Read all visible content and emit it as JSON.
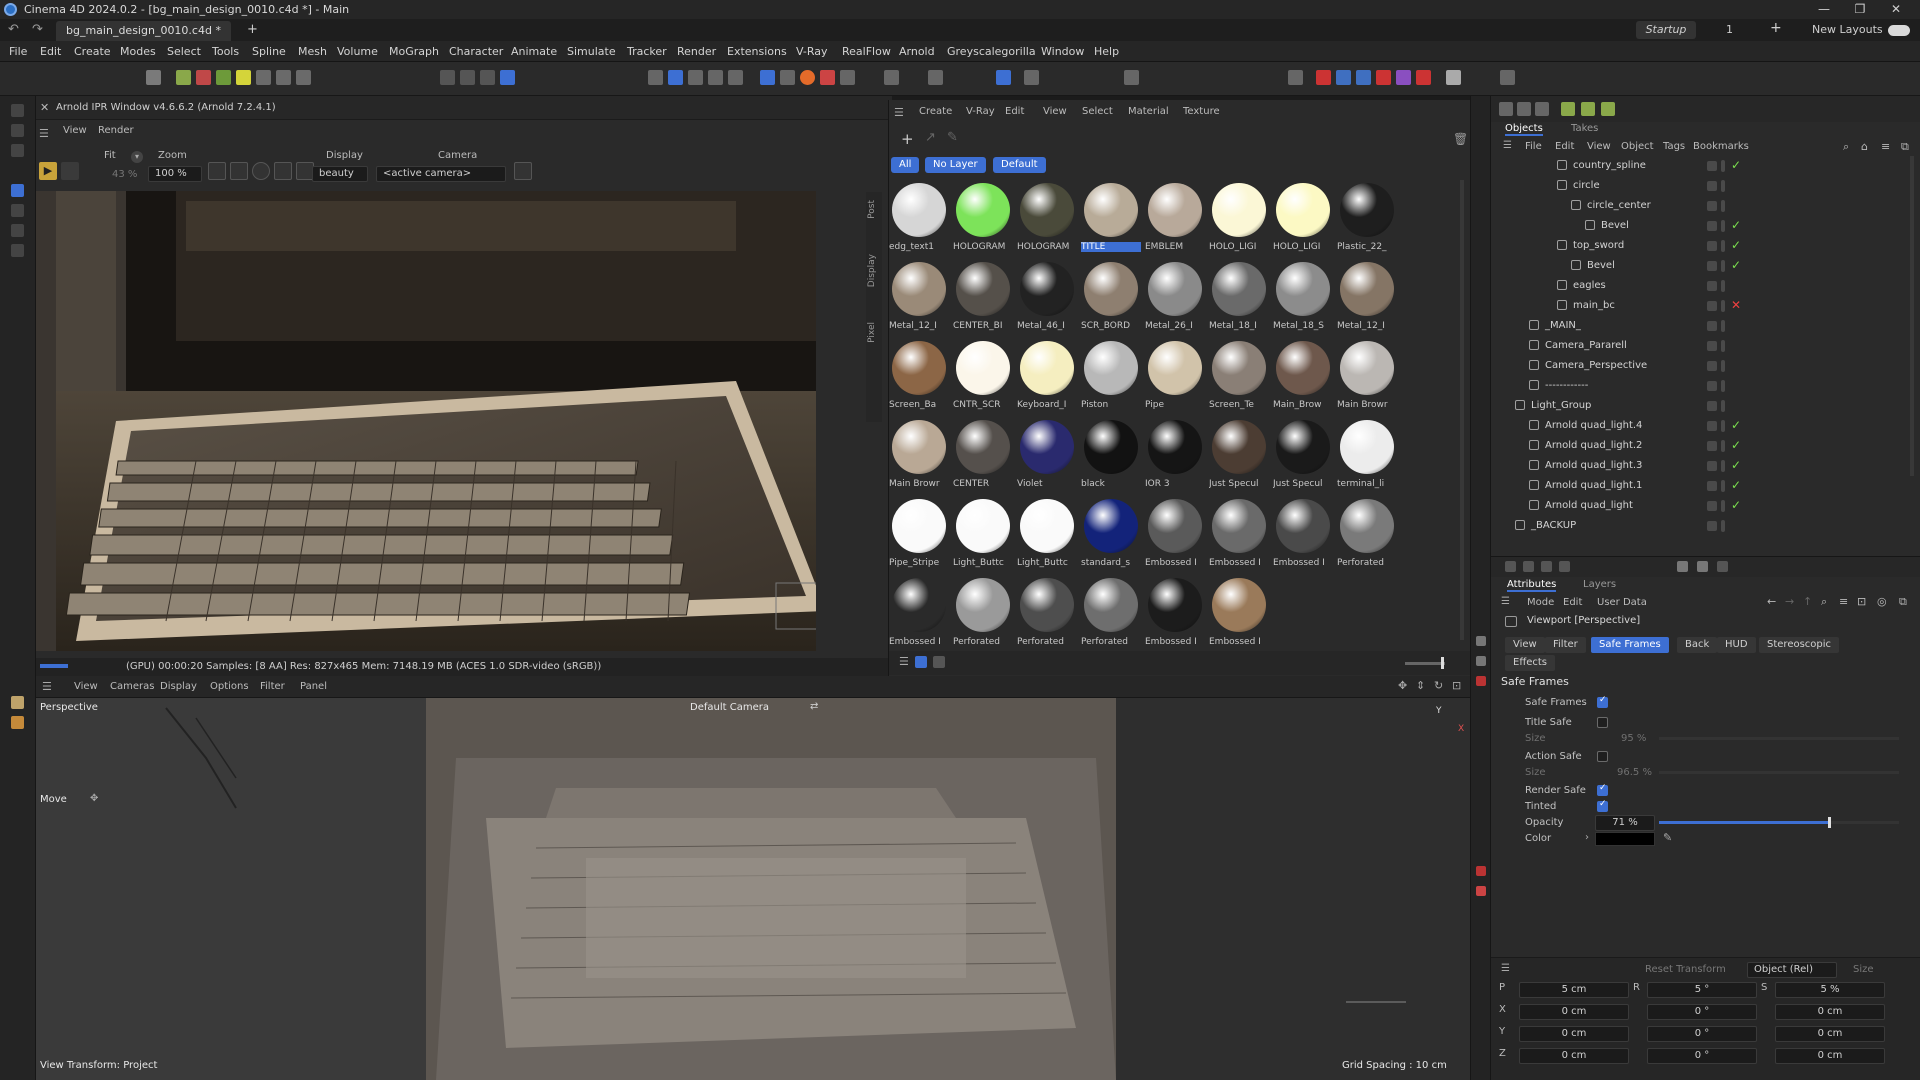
{
  "window": {
    "title": "Cinema 4D 2024.0.2 - [bg_main_design_0010.c4d *] - Main",
    "doc_tab": "bg_main_design_0010.c4d *",
    "layout_tabs": [
      "Startup",
      "1",
      "New Layouts"
    ]
  },
  "menu": [
    "File",
    "Edit",
    "Create",
    "Modes",
    "Select",
    "Tools",
    "Spline",
    "Mesh",
    "Volume",
    "MoGraph",
    "Character",
    "Animate",
    "Simulate",
    "Tracker",
    "Render",
    "Extensions",
    "V-Ray",
    "RealFlow",
    "Arnold",
    "Greyscalegorilla",
    "Window",
    "Help"
  ],
  "ipr": {
    "title": "Arnold IPR Window v4.6.6.2 (Arnold 7.2.4.1)",
    "menu": [
      "View",
      "Render"
    ],
    "fit_label": "Fit",
    "fit_value": "43 %",
    "zoom_label": "Zoom",
    "zoom_value": "100 %",
    "display_label": "Display",
    "display_value": "beauty",
    "camera_label": "Camera",
    "camera_value": "<active camera>",
    "side_tabs": [
      "Post",
      "Display",
      "Pixel"
    ],
    "status": "(GPU)  00:00:20  Samples: [8 AA]  Res: 827x465  Mem: 7148.19 MB  (ACES 1.0 SDR-video (sRGB))"
  },
  "materials": {
    "menu": [
      "Create",
      "V-Ray",
      "Edit",
      "View",
      "Select",
      "Material",
      "Texture"
    ],
    "filters": [
      "All",
      "No Layer",
      "Default"
    ],
    "items": [
      {
        "label": "edg_text1",
        "color": "#d6d6d6"
      },
      {
        "label": "HOLOGRAM",
        "color": "#7de35a"
      },
      {
        "label": "HOLOGRAM",
        "color": "#4a4a3a"
      },
      {
        "label": "TITLE",
        "color": "#b8ab98"
      },
      {
        "label": "EMBLEM",
        "color": "#b8a99a"
      },
      {
        "label": "HOLO_LIGI",
        "color": "#fbf7d6"
      },
      {
        "label": "HOLO_LIGI",
        "color": "#fcf9c4"
      },
      {
        "label": "Plastic_22_",
        "color": "#1e1e1e"
      },
      {
        "label": "Metal_12_I",
        "color": "#9a8a78"
      },
      {
        "label": "CENTER_BI",
        "color": "#55504a"
      },
      {
        "label": "Metal_46_I",
        "color": "#222222"
      },
      {
        "label": "SCR_BORD",
        "color": "#8e7f70"
      },
      {
        "label": "Metal_26_I",
        "color": "#8a8a8a"
      },
      {
        "label": "Metal_18_I",
        "color": "#6a6a6a"
      },
      {
        "label": "Metal_18_S",
        "color": "#8c8c8c"
      },
      {
        "label": "Metal_12_I",
        "color": "#857565"
      },
      {
        "label": "Screen_Ba",
        "color": "#8c6646"
      },
      {
        "label": "CNTR_SCR",
        "color": "#fbf6ea"
      },
      {
        "label": "Keyboard_I",
        "color": "#f5eec0"
      },
      {
        "label": "Piston",
        "color": "#b8b8b8"
      },
      {
        "label": "Pipe",
        "color": "#d1c3aa"
      },
      {
        "label": "Screen_Te",
        "color": "#8a7f76"
      },
      {
        "label": "Main_Brow",
        "color": "#6e584c"
      },
      {
        "label": "Main Browr",
        "color": "#bbb7b3"
      },
      {
        "label": "Main Browr",
        "color": "#b9a895"
      },
      {
        "label": "CENTER",
        "color": "#55504c"
      },
      {
        "label": "Violet",
        "color": "#2a2a6e"
      },
      {
        "label": "black",
        "color": "#121212"
      },
      {
        "label": "IOR 3",
        "color": "#151515"
      },
      {
        "label": "Just Specul",
        "color": "#4c3d33"
      },
      {
        "label": "Just Specul",
        "color": "#1a1a1a"
      },
      {
        "label": "terminal_li",
        "color": "#ececec"
      },
      {
        "label": "Pipe_Stripe",
        "color": "#fafafa"
      },
      {
        "label": "Light_Buttc",
        "color": "#fafafa"
      },
      {
        "label": "Light_Buttc",
        "color": "#fafafa"
      },
      {
        "label": "standard_s",
        "color": "#13237a"
      },
      {
        "label": "Embossed I",
        "color": "#5a5a5a"
      },
      {
        "label": "Embossed I",
        "color": "#6a6a6a"
      },
      {
        "label": "Embossed I",
        "color": "#4a4a4a"
      },
      {
        "label": "Perforated",
        "color": "#7a7a7a"
      },
      {
        "label": "Embossed I",
        "color": "#2a2a2a"
      },
      {
        "label": "Perforated",
        "color": "#9a9a9a"
      },
      {
        "label": "Perforated",
        "color": "#4e4e4e"
      },
      {
        "label": "Perforated",
        "color": "#6e6e6e"
      },
      {
        "label": "Embossed I",
        "color": "#1c1c1c"
      },
      {
        "label": "Embossed I",
        "color": "#9a7a5a"
      }
    ]
  },
  "objects": {
    "tabs": [
      "Objects",
      "Takes"
    ],
    "menu": [
      "File",
      "Edit",
      "View",
      "Object",
      "Tags",
      "Bookmarks"
    ],
    "rows": [
      {
        "name": "country_spline",
        "indent": 3,
        "check": true
      },
      {
        "name": "circle",
        "indent": 3
      },
      {
        "name": "circle_center",
        "indent": 4
      },
      {
        "name": "Bevel",
        "indent": 5,
        "check": true
      },
      {
        "name": "top_sword",
        "indent": 3,
        "check": true
      },
      {
        "name": "Bevel",
        "indent": 4,
        "check": true
      },
      {
        "name": "eagles",
        "indent": 3
      },
      {
        "name": "main_bc",
        "indent": 3,
        "x": true
      },
      {
        "name": "_MAIN_",
        "indent": 1
      },
      {
        "name": "Camera_Pararell",
        "indent": 1
      },
      {
        "name": "Camera_Perspective",
        "indent": 1
      },
      {
        "name": "------------",
        "indent": 1
      },
      {
        "name": "Light_Group",
        "indent": 0
      },
      {
        "name": "Arnold quad_light.4",
        "indent": 1,
        "check": true
      },
      {
        "name": "Arnold quad_light.2",
        "indent": 1,
        "check": true
      },
      {
        "name": "Arnold quad_light.3",
        "indent": 1,
        "check": true
      },
      {
        "name": "Arnold quad_light.1",
        "indent": 1,
        "check": true
      },
      {
        "name": "Arnold quad_light",
        "indent": 1,
        "check": true
      },
      {
        "name": "_BACKUP",
        "indent": 0
      }
    ]
  },
  "attributes": {
    "tabs": [
      "Attributes",
      "Layers"
    ],
    "menu": [
      "Mode",
      "Edit",
      "User Data"
    ],
    "object_title": "Viewport [Perspective]",
    "sub_tabs": [
      "View",
      "Filter",
      "Safe Frames",
      "Back",
      "HUD",
      "Stereoscopic",
      "Effects"
    ],
    "section": "Safe Frames",
    "safe_frames": "Safe Frames",
    "title_safe": "Title Safe",
    "title_size_label": "Size",
    "title_size": "95 %",
    "action_safe": "Action Safe",
    "action_size_label": "Size",
    "action_size": "96.5 %",
    "render_safe": "Render Safe",
    "tinted": "Tinted",
    "opacity_label": "Opacity",
    "opacity": "71 %",
    "opacity_fraction": 0.71,
    "color_label": "Color"
  },
  "coords": {
    "reset_transform": "Reset Transform",
    "mode": "Object (Rel)",
    "size": "Size",
    "rows": [
      {
        "axis": "P",
        "v1": "5 cm",
        "rlabel": "R",
        "v2": "5 °",
        "slabel": "S",
        "v3": "5 %"
      },
      {
        "axis": "X",
        "v1": "0 cm",
        "v2": "0 °",
        "v3": "0 cm"
      },
      {
        "axis": "Y",
        "v1": "0 cm",
        "v2": "0 °",
        "v3": "0 cm"
      },
      {
        "axis": "Z",
        "v1": "0 cm",
        "v2": "0 °",
        "v3": "0 cm"
      }
    ]
  },
  "viewport": {
    "menu": [
      "View",
      "Cameras",
      "Display",
      "Options",
      "Filter",
      "Panel"
    ],
    "name": "Perspective",
    "camera": "Default Camera",
    "tool": "Move",
    "transform": "View Transform: Project",
    "grid": "Grid Spacing : 10 cm"
  }
}
